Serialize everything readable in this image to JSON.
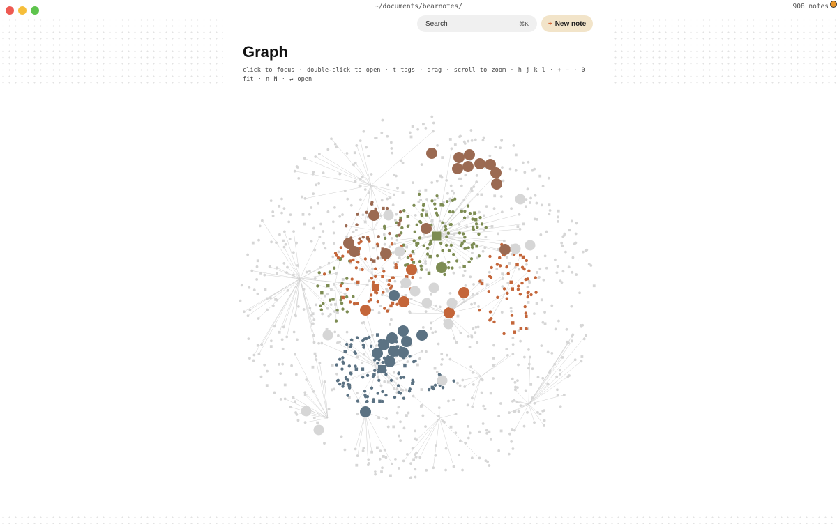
{
  "window": {
    "path": "~/documents/bearnotes/",
    "note_count": "908 notes"
  },
  "toolbar": {
    "search_placeholder": "Search",
    "search_shortcut": "⌘K",
    "new_note_plus": "+",
    "new_note_label": "New note"
  },
  "page": {
    "title": "Graph",
    "hint": "click to focus · double-click to open · t tags · drag · scroll to zoom · h j k l · + − · 0 fit · n N · ↵ open"
  },
  "colors": {
    "gray": "#d6d6d6",
    "brown": "#9b6a52",
    "olive": "#7d8c53",
    "orange": "#c4663a",
    "slate": "#5b7283",
    "edge": "#cfcfcf",
    "new_note_bg": "#f2e4c9"
  },
  "graph_summary": {
    "total_notes": 908,
    "clusters": [
      "brown",
      "olive",
      "orange",
      "slate"
    ]
  }
}
